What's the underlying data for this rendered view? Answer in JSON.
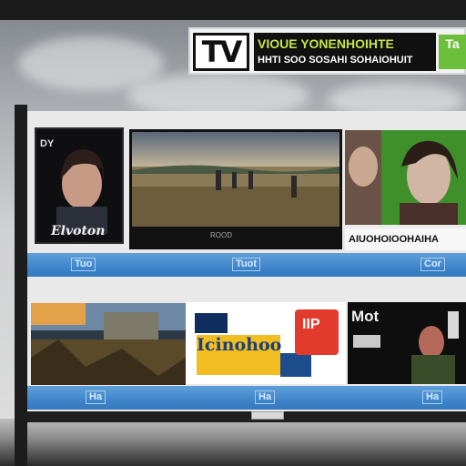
{
  "banner": {
    "logo": "TV",
    "title": "VIOUE YONENHOIHTE",
    "subtitle": "HHTI SOO SOSAHI SOHAIOHUIT",
    "side_label": "Ta"
  },
  "row1": {
    "tiles": [
      {
        "caption": "Elvoton",
        "header": "DY"
      },
      {
        "caption": ""
      },
      {
        "caption": "AIUOHOIOOHAIHA"
      }
    ],
    "shelf_labels": [
      "Tuo",
      "Tuot",
      "Cor"
    ]
  },
  "row2": {
    "tiles": [
      {
        "caption": ""
      },
      {
        "caption": "Icinohoo",
        "badge": "IIP"
      },
      {
        "caption": "Mot"
      }
    ],
    "shelf_labels": [
      "Ha",
      "Ha",
      "Ha"
    ]
  },
  "colors": {
    "shelf_blue": "#3f86cc",
    "banner_green": "#6cbf3a",
    "banner_accent": "#c7e34a"
  }
}
